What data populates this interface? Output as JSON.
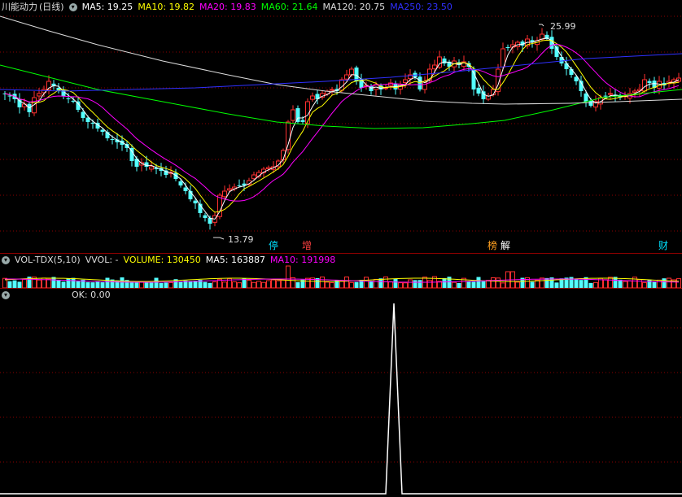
{
  "main": {
    "stock_name": "川能动力",
    "period": "(日线)",
    "indicators": [
      {
        "label": "MA5: 19.25",
        "color": "#ffffff"
      },
      {
        "label": "MA10: 19.82",
        "color": "#ffff00"
      },
      {
        "label": "MA20: 19.83",
        "color": "#ff00ff"
      },
      {
        "label": "MA60: 21.64",
        "color": "#00ff00"
      },
      {
        "label": "MA120: 20.75",
        "color": "#dddddd"
      },
      {
        "label": "MA250: 23.50",
        "color": "#3030ff"
      }
    ],
    "high_label": "25.99",
    "low_label": "13.79",
    "flags": [
      {
        "text": "停",
        "color": "#00e0ff"
      },
      {
        "text": "增",
        "color": "#ff4040"
      },
      {
        "text": "榜",
        "color": "#ffa020"
      },
      {
        "text": "解",
        "color": "#ffffff"
      },
      {
        "text": "财",
        "color": "#00e0ff"
      }
    ]
  },
  "volume_panel": {
    "indicator_name": "VOL-TDX(5,10)",
    "vvol": "VVOL: -",
    "volume": "VOLUME: 130450",
    "ma5": "MA5: 163887",
    "ma10": "MA10: 191998",
    "colors": {
      "vvol": "#dddddd",
      "volume": "#ffff00",
      "ma5": "#ffffff",
      "ma10": "#ff00ff"
    }
  },
  "ok_panel": {
    "label": "OK: 0.00"
  },
  "colors": {
    "up": "#ff3030",
    "down": "#54ffff",
    "grid": "#8b0000"
  }
}
